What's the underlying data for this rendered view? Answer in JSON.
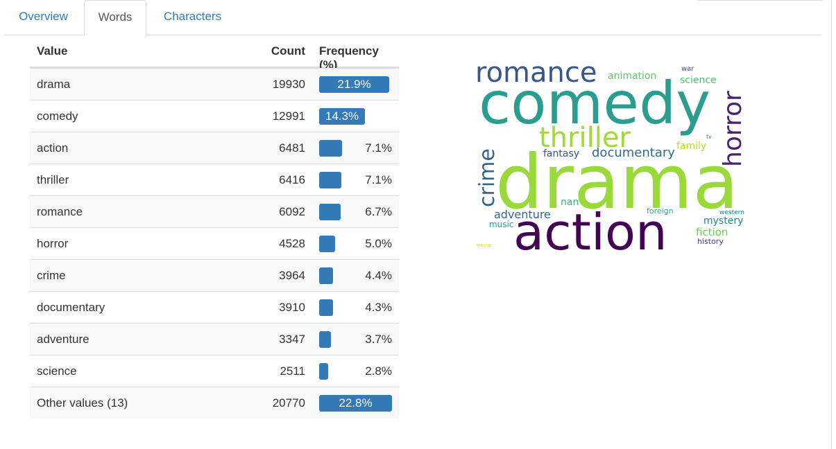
{
  "tabs": [
    {
      "label": "Overview",
      "active": false
    },
    {
      "label": "Words",
      "active": true
    },
    {
      "label": "Characters",
      "active": false
    }
  ],
  "table": {
    "headers": {
      "value": "Value",
      "count": "Count",
      "frequency": "Frequency (%)"
    },
    "rows": [
      {
        "value": "drama",
        "count": "19930",
        "pct": "21.9%",
        "frac": 0.959,
        "label_inside": true
      },
      {
        "value": "comedy",
        "count": "12991",
        "pct": "14.3%",
        "frac": 0.626,
        "label_inside": true
      },
      {
        "value": "action",
        "count": "6481",
        "pct": "7.1%",
        "frac": 0.312,
        "label_inside": false
      },
      {
        "value": "thriller",
        "count": "6416",
        "pct": "7.1%",
        "frac": 0.309,
        "label_inside": false
      },
      {
        "value": "romance",
        "count": "6092",
        "pct": "6.7%",
        "frac": 0.293,
        "label_inside": false
      },
      {
        "value": "horror",
        "count": "4528",
        "pct": "5.0%",
        "frac": 0.218,
        "label_inside": false
      },
      {
        "value": "crime",
        "count": "3964",
        "pct": "4.4%",
        "frac": 0.191,
        "label_inside": false
      },
      {
        "value": "documentary",
        "count": "3910",
        "pct": "4.3%",
        "frac": 0.188,
        "label_inside": false
      },
      {
        "value": "adventure",
        "count": "3347",
        "pct": "3.7%",
        "frac": 0.161,
        "label_inside": false
      },
      {
        "value": "science",
        "count": "2511",
        "pct": "2.8%",
        "frac": 0.121,
        "label_inside": false
      },
      {
        "value": "Other values (13)",
        "count": "20770",
        "pct": "22.8%",
        "frac": 1.0,
        "label_inside": true
      }
    ]
  },
  "wordcloud": {
    "words": [
      {
        "text": "drama",
        "color": "#9ad93a"
      },
      {
        "text": "comedy",
        "color": "#2a9d8f"
      },
      {
        "text": "action",
        "color": "#440154"
      },
      {
        "text": "romance",
        "color": "#39568c"
      },
      {
        "text": "thriller",
        "color": "#a0da39"
      },
      {
        "text": "horror",
        "color": "#482173"
      },
      {
        "text": "crime",
        "color": "#33638d"
      },
      {
        "text": "documentary",
        "color": "#31688e"
      },
      {
        "text": "fantasy",
        "color": "#3b528b"
      },
      {
        "text": "family",
        "color": "#b5de2b"
      },
      {
        "text": "animation",
        "color": "#5ec962"
      },
      {
        "text": "science",
        "color": "#4ac16d"
      },
      {
        "text": "war",
        "color": "#3e4a89"
      },
      {
        "text": "tv",
        "color": "#26828e"
      },
      {
        "text": "adventure",
        "color": "#31688e"
      },
      {
        "text": "nan",
        "color": "#35b779"
      },
      {
        "text": "foreign",
        "color": "#2db27d"
      },
      {
        "text": "western",
        "color": "#277f8e"
      },
      {
        "text": "mystery",
        "color": "#23888e"
      },
      {
        "text": "music",
        "color": "#1fa187"
      },
      {
        "text": "fiction",
        "color": "#6ece58"
      },
      {
        "text": "history",
        "color": "#414487"
      },
      {
        "text": "movie",
        "color": "#dde318"
      }
    ]
  },
  "colors": {
    "bar": "#337ab7",
    "link": "#337ab7",
    "border": "#dddddd"
  }
}
